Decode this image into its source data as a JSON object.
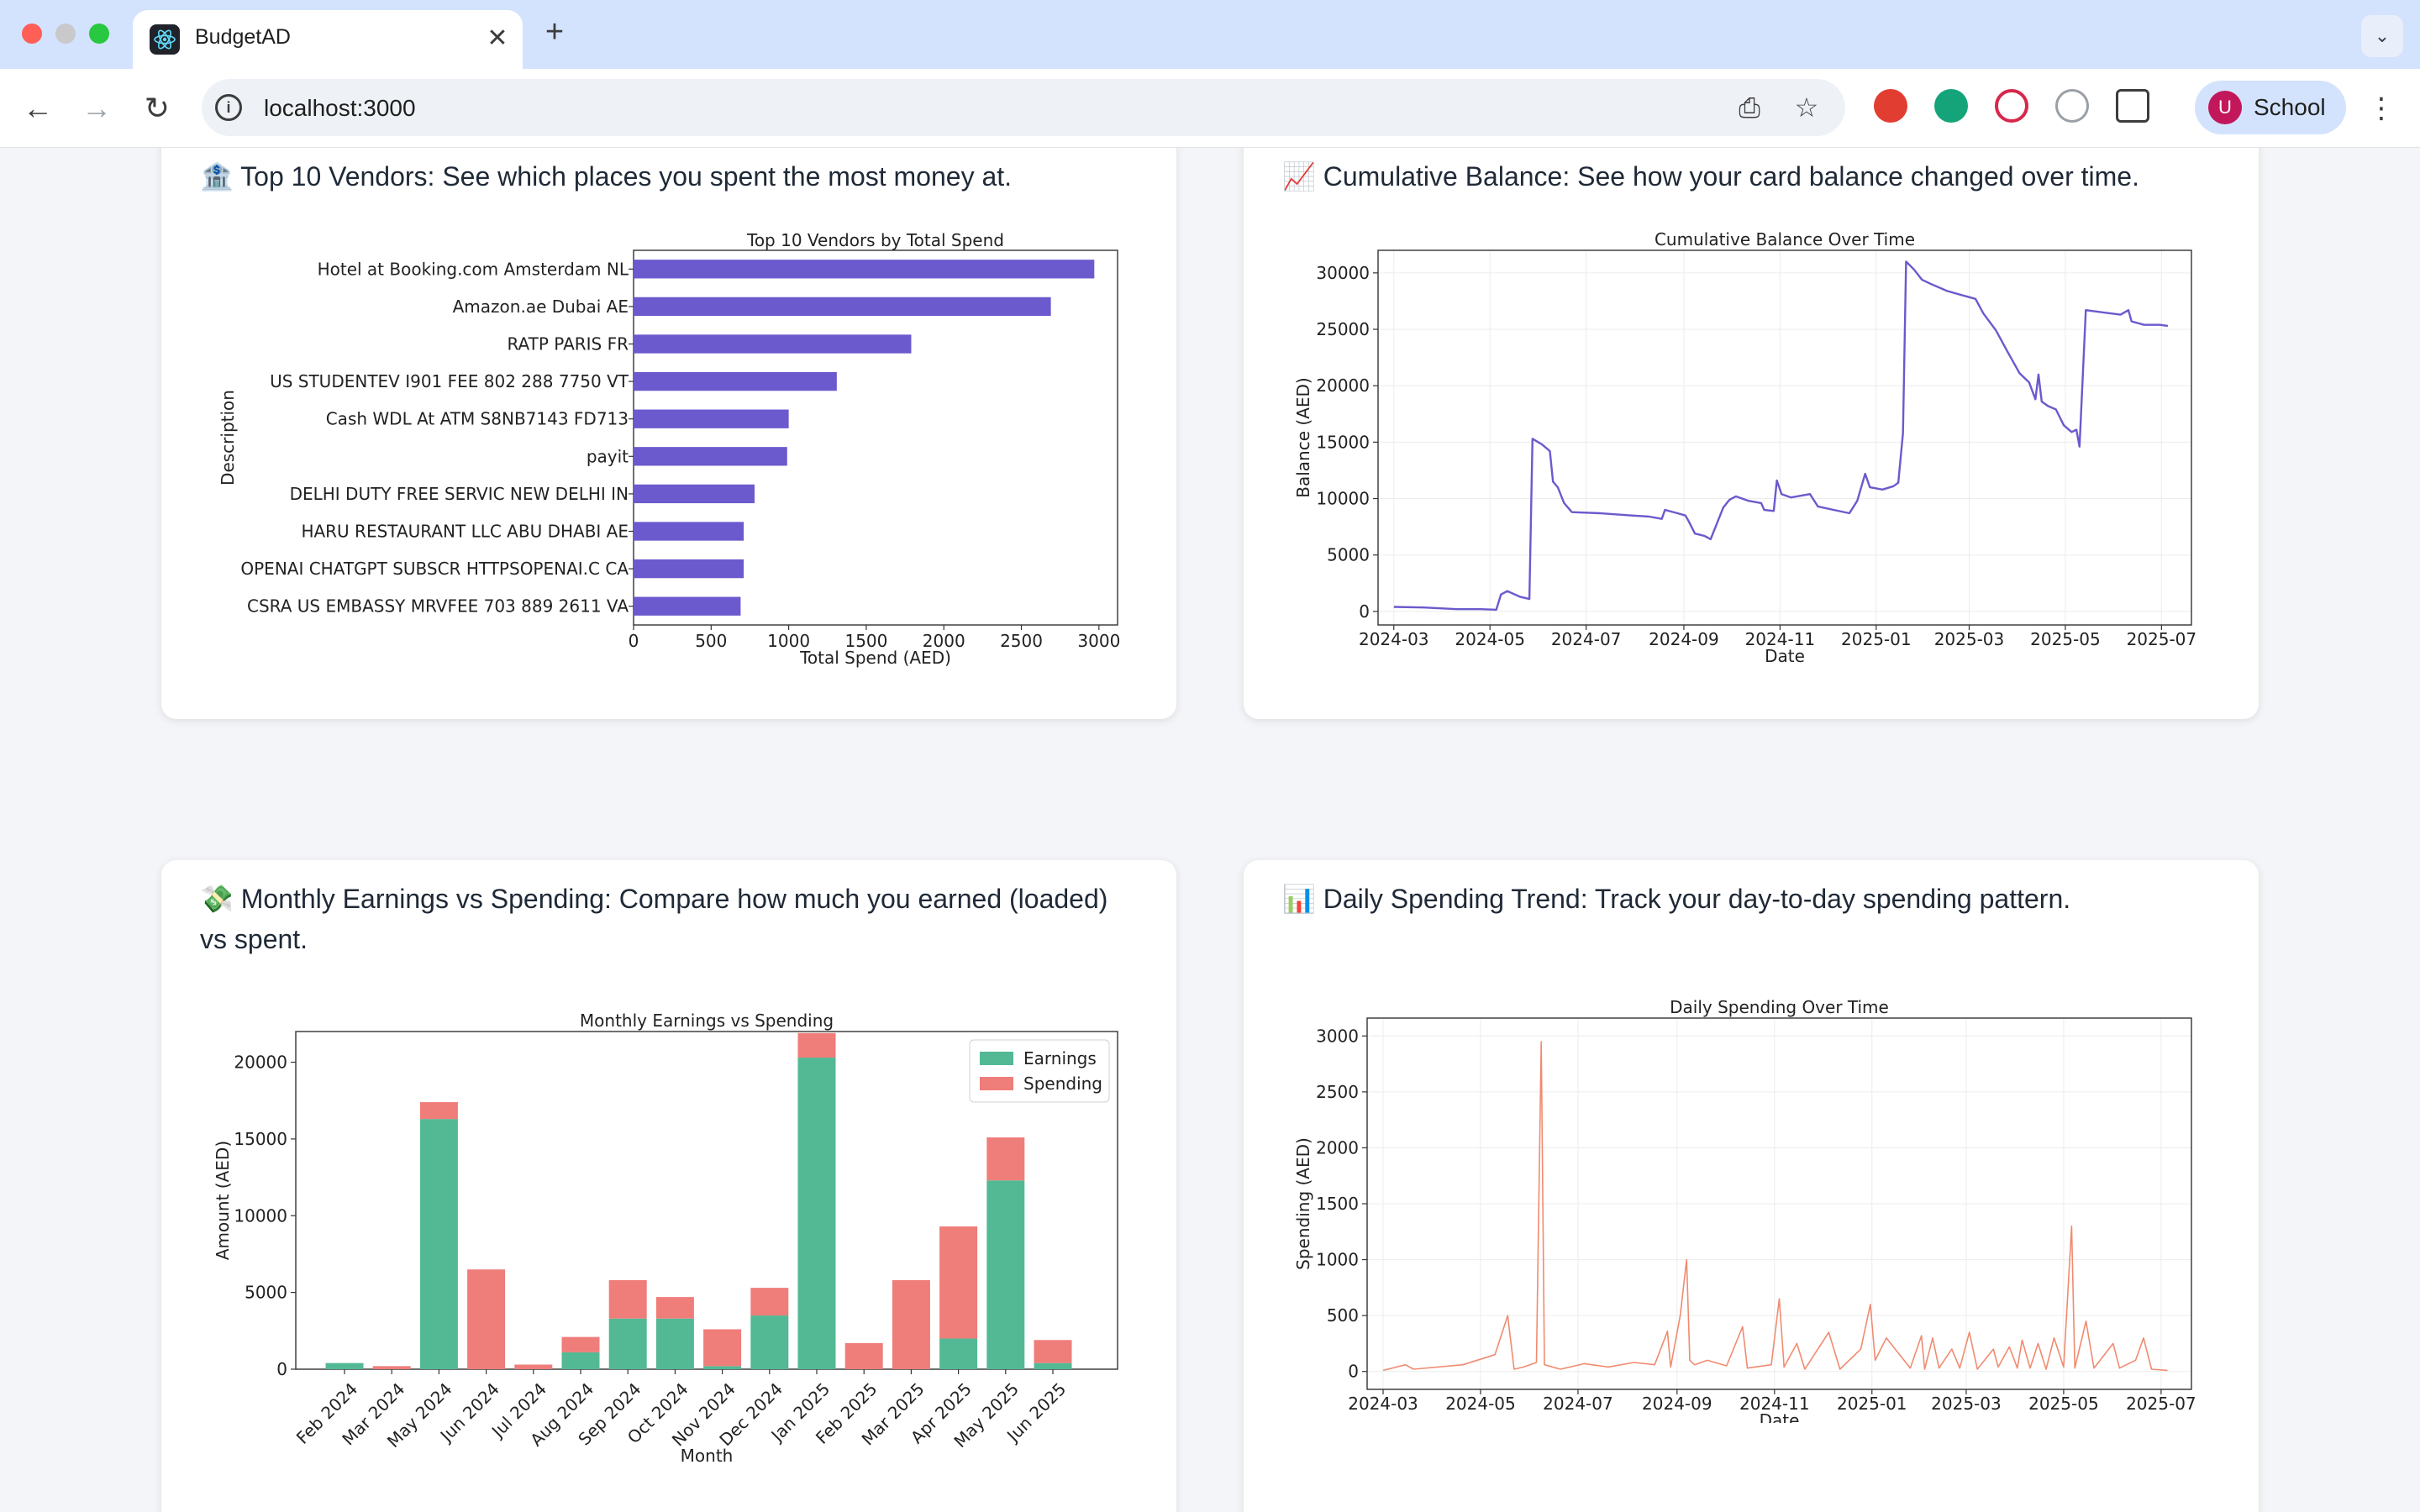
{
  "browser": {
    "tab_title": "BudgetAD",
    "tab_close": "✕",
    "new_tab": "+",
    "tab_menu": "⌄",
    "url": "localhost:3000",
    "profile_initial": "U",
    "profile_name": "School",
    "icons": [
      "back-icon",
      "forward-icon",
      "reload-icon",
      "info-icon",
      "install-icon",
      "bookmark-star-icon",
      "ublock-icon",
      "grammarly-icon",
      "screen-recorder-icon",
      "timer-icon",
      "extensions-icon",
      "kebab-menu-icon"
    ]
  },
  "cards": {
    "vendors": {
      "title": "🏦 Top 10 Vendors: See which places you spent the most money at."
    },
    "balance": {
      "title": "📈 Cumulative Balance: See how your card balance changed over time."
    },
    "monthly": {
      "title_line1": "💸 Monthly Earnings vs Spending: Compare how much you earned (loaded)",
      "title_line2": "vs spent."
    },
    "daily": {
      "title": "📊 Daily Spending Trend: Track your day-to-day spending pattern."
    }
  },
  "chart_data": [
    {
      "id": "vendors",
      "type": "bar",
      "orientation": "horizontal",
      "title": "Top 10 Vendors by Total Spend",
      "xlabel": "Total Spend (AED)",
      "ylabel": "Description",
      "xlim": [
        0,
        3120
      ],
      "xticks": [
        0,
        500,
        1000,
        1500,
        2000,
        2500,
        3000
      ],
      "color": "#6a5acd",
      "categories": [
        "Hotel at Booking.com Amsterdam NL",
        "Amazon.ae Dubai AE",
        "RATP PARIS FR",
        "US STUDENTEV I901 FEE 802 288 7750 VT",
        "Cash WDL At ATM S8NB7143 FD713",
        "payit",
        "DELHI DUTY FREE SERVIC NEW DELHI IN",
        "HARU RESTAURANT LLC ABU DHABI AE",
        "OPENAI CHATGPT SUBSCR HTTPSOPENAI.C CA",
        "CSRA US EMBASSY MRVFEE 703 889 2611 VA"
      ],
      "values": [
        2970,
        2690,
        1790,
        1310,
        1000,
        990,
        780,
        710,
        710,
        690
      ]
    },
    {
      "id": "balance",
      "type": "line",
      "title": "Cumulative Balance Over Time",
      "xlabel": "Date",
      "ylabel": "Balance (AED)",
      "xlim": [
        "2024-02-20",
        "2025-07-20"
      ],
      "ylim": [
        -1200,
        32000
      ],
      "xticks": [
        "2024-03",
        "2024-05",
        "2024-07",
        "2024-09",
        "2024-11",
        "2025-01",
        "2025-03",
        "2025-05",
        "2025-07"
      ],
      "yticks": [
        0,
        5000,
        10000,
        15000,
        20000,
        25000,
        30000
      ],
      "color": "#6a5acd",
      "points": [
        [
          "2024-03-01",
          400
        ],
        [
          "2024-03-20",
          350
        ],
        [
          "2024-04-10",
          200
        ],
        [
          "2024-04-25",
          200
        ],
        [
          "2024-05-05",
          150
        ],
        [
          "2024-05-08",
          1500
        ],
        [
          "2024-05-12",
          1800
        ],
        [
          "2024-05-20",
          1300
        ],
        [
          "2024-05-26",
          1100
        ],
        [
          "2024-05-28",
          15300
        ],
        [
          "2024-06-03",
          14800
        ],
        [
          "2024-06-08",
          14200
        ],
        [
          "2024-06-10",
          11500
        ],
        [
          "2024-06-13",
          11000
        ],
        [
          "2024-06-17",
          9600
        ],
        [
          "2024-06-22",
          8800
        ],
        [
          "2024-07-10",
          8700
        ],
        [
          "2024-07-30",
          8500
        ],
        [
          "2024-08-10",
          8400
        ],
        [
          "2024-08-18",
          8200
        ],
        [
          "2024-08-20",
          9000
        ],
        [
          "2024-08-28",
          8700
        ],
        [
          "2024-09-02",
          8500
        ],
        [
          "2024-09-04",
          8000
        ],
        [
          "2024-09-08",
          6900
        ],
        [
          "2024-09-14",
          6700
        ],
        [
          "2024-09-18",
          6400
        ],
        [
          "2024-09-22",
          7800
        ],
        [
          "2024-09-26",
          9200
        ],
        [
          "2024-09-30",
          9900
        ],
        [
          "2024-10-04",
          10200
        ],
        [
          "2024-10-12",
          9800
        ],
        [
          "2024-10-20",
          9600
        ],
        [
          "2024-10-22",
          9000
        ],
        [
          "2024-10-28",
          8900
        ],
        [
          "2024-10-30",
          11600
        ],
        [
          "2024-11-02",
          10400
        ],
        [
          "2024-11-08",
          10100
        ],
        [
          "2024-11-20",
          10400
        ],
        [
          "2024-11-25",
          9300
        ],
        [
          "2024-12-05",
          9000
        ],
        [
          "2024-12-15",
          8700
        ],
        [
          "2024-12-20",
          9800
        ],
        [
          "2024-12-25",
          12200
        ],
        [
          "2024-12-28",
          11000
        ],
        [
          "2025-01-05",
          10800
        ],
        [
          "2025-01-12",
          11100
        ],
        [
          "2025-01-15",
          11400
        ],
        [
          "2025-01-18",
          15800
        ],
        [
          "2025-01-20",
          31000
        ],
        [
          "2025-01-25",
          30300
        ],
        [
          "2025-01-30",
          29400
        ],
        [
          "2025-02-05",
          29000
        ],
        [
          "2025-02-15",
          28400
        ],
        [
          "2025-02-25",
          28000
        ],
        [
          "2025-03-05",
          27700
        ],
        [
          "2025-03-10",
          26400
        ],
        [
          "2025-03-18",
          24900
        ],
        [
          "2025-03-25",
          23100
        ],
        [
          "2025-04-02",
          21100
        ],
        [
          "2025-04-08",
          20300
        ],
        [
          "2025-04-12",
          18800
        ],
        [
          "2025-04-14",
          21000
        ],
        [
          "2025-04-16",
          18600
        ],
        [
          "2025-04-20",
          18200
        ],
        [
          "2025-04-25",
          17900
        ],
        [
          "2025-04-30",
          16500
        ],
        [
          "2025-05-05",
          15900
        ],
        [
          "2025-05-08",
          16100
        ],
        [
          "2025-05-10",
          14600
        ],
        [
          "2025-05-14",
          26700
        ],
        [
          "2025-05-25",
          26500
        ],
        [
          "2025-06-05",
          26300
        ],
        [
          "2025-06-10",
          26700
        ],
        [
          "2025-06-12",
          25700
        ],
        [
          "2025-06-20",
          25400
        ],
        [
          "2025-06-30",
          25400
        ],
        [
          "2025-07-05",
          25300
        ]
      ]
    },
    {
      "id": "monthly",
      "type": "bar",
      "stacked": true,
      "title": "Monthly Earnings vs Spending",
      "xlabel": "Month",
      "ylabel": "Amount (AED)",
      "ylim": [
        0,
        22000
      ],
      "yticks": [
        0,
        5000,
        10000,
        15000,
        20000
      ],
      "legend_position": "top-right",
      "categories": [
        "Feb 2024",
        "Mar 2024",
        "May 2024",
        "Jun 2024",
        "Jul 2024",
        "Aug 2024",
        "Sep 2024",
        "Oct 2024",
        "Nov 2024",
        "Dec 2024",
        "Jan 2025",
        "Feb 2025",
        "Mar 2025",
        "Apr 2025",
        "May 2025",
        "Jun 2025"
      ],
      "series": [
        {
          "name": "Earnings",
          "color": "#52b994",
          "values": [
            400,
            0,
            16300,
            0,
            0,
            1100,
            3300,
            3300,
            200,
            3500,
            20300,
            0,
            0,
            2000,
            12300,
            400
          ]
        },
        {
          "name": "Spending",
          "color": "#ef7d7a",
          "values": [
            0,
            200,
            1100,
            6500,
            300,
            1000,
            2500,
            1400,
            2400,
            1800,
            1600,
            1700,
            5800,
            7300,
            2800,
            1500
          ]
        }
      ]
    },
    {
      "id": "daily",
      "type": "line",
      "title": "Daily Spending Over Time",
      "xlabel": "Date",
      "ylabel": "Spending (AED)",
      "xlim": [
        "2024-02-20",
        "2025-07-20"
      ],
      "ylim": [
        -160,
        3160
      ],
      "xticks": [
        "2024-03",
        "2024-05",
        "2024-07",
        "2024-09",
        "2024-11",
        "2025-01",
        "2025-03",
        "2025-05",
        "2025-07"
      ],
      "yticks": [
        0,
        500,
        1000,
        1500,
        2000,
        2500,
        3000
      ],
      "color": "#f08b70",
      "points": [
        [
          "2024-03-01",
          10
        ],
        [
          "2024-03-15",
          60
        ],
        [
          "2024-03-20",
          20
        ],
        [
          "2024-04-20",
          60
        ],
        [
          "2024-05-10",
          150
        ],
        [
          "2024-05-18",
          500
        ],
        [
          "2024-05-22",
          20
        ],
        [
          "2024-05-28",
          40
        ],
        [
          "2024-06-05",
          80
        ],
        [
          "2024-06-08",
          2950
        ],
        [
          "2024-06-10",
          60
        ],
        [
          "2024-06-20",
          20
        ],
        [
          "2024-07-05",
          70
        ],
        [
          "2024-07-20",
          40
        ],
        [
          "2024-08-05",
          80
        ],
        [
          "2024-08-18",
          60
        ],
        [
          "2024-08-26",
          360
        ],
        [
          "2024-08-28",
          40
        ],
        [
          "2024-09-03",
          500
        ],
        [
          "2024-09-07",
          1000
        ],
        [
          "2024-09-09",
          100
        ],
        [
          "2024-09-12",
          60
        ],
        [
          "2024-09-20",
          100
        ],
        [
          "2024-10-02",
          50
        ],
        [
          "2024-10-12",
          400
        ],
        [
          "2024-10-15",
          30
        ],
        [
          "2024-10-30",
          60
        ],
        [
          "2024-11-04",
          650
        ],
        [
          "2024-11-07",
          40
        ],
        [
          "2024-11-15",
          250
        ],
        [
          "2024-11-20",
          20
        ],
        [
          "2024-12-05",
          350
        ],
        [
          "2024-12-12",
          20
        ],
        [
          "2024-12-25",
          200
        ],
        [
          "2024-12-31",
          600
        ],
        [
          "2025-01-03",
          100
        ],
        [
          "2025-01-10",
          300
        ],
        [
          "2025-01-25",
          30
        ],
        [
          "2025-02-01",
          320
        ],
        [
          "2025-02-03",
          20
        ],
        [
          "2025-02-08",
          300
        ],
        [
          "2025-02-12",
          30
        ],
        [
          "2025-02-20",
          200
        ],
        [
          "2025-02-25",
          30
        ],
        [
          "2025-03-03",
          350
        ],
        [
          "2025-03-08",
          20
        ],
        [
          "2025-03-18",
          200
        ],
        [
          "2025-03-21",
          40
        ],
        [
          "2025-03-28",
          220
        ],
        [
          "2025-04-02",
          30
        ],
        [
          "2025-04-05",
          280
        ],
        [
          "2025-04-10",
          30
        ],
        [
          "2025-04-15",
          250
        ],
        [
          "2025-04-20",
          20
        ],
        [
          "2025-04-25",
          300
        ],
        [
          "2025-05-01",
          40
        ],
        [
          "2025-05-06",
          1300
        ],
        [
          "2025-05-08",
          30
        ],
        [
          "2025-05-15",
          450
        ],
        [
          "2025-05-20",
          30
        ],
        [
          "2025-06-01",
          250
        ],
        [
          "2025-06-05",
          30
        ],
        [
          "2025-06-15",
          100
        ],
        [
          "2025-06-20",
          300
        ],
        [
          "2025-06-25",
          20
        ],
        [
          "2025-07-05",
          10
        ]
      ]
    }
  ]
}
